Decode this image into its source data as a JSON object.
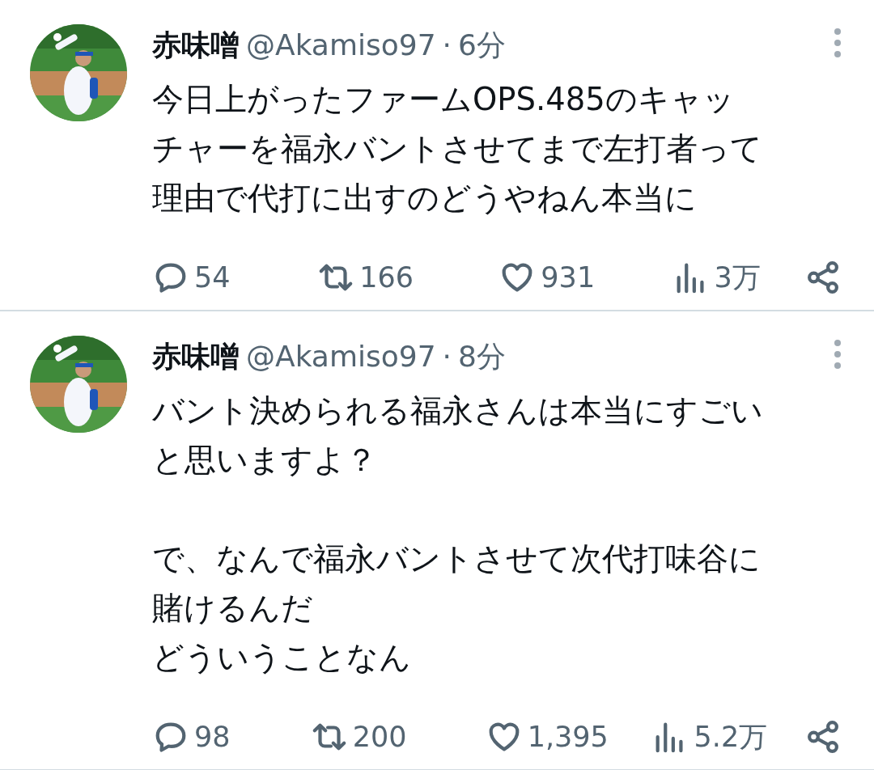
{
  "tweets": [
    {
      "name": "赤味噌",
      "handle": "@Akamiso97",
      "separator": "·",
      "time": "6分",
      "paragraphs": [
        [
          "今日上がったファームOPS.485のキャッ",
          "チャーを福永バントさせてまで左打者って",
          "理由で代打に出すのどうやねん本当に"
        ]
      ],
      "replies": "54",
      "retweets": "166",
      "likes": "931",
      "views": "3万"
    },
    {
      "name": "赤味噌",
      "handle": "@Akamiso97",
      "separator": "·",
      "time": "8分",
      "paragraphs": [
        [
          "バント決められる福永さんは本当にすごい",
          "と思いますよ？"
        ],
        [
          "で、なんで福永バントさせて次代打味谷に",
          "賭けるんだ",
          "どういうことなん"
        ]
      ],
      "replies": "98",
      "retweets": "200",
      "likes": "1,395",
      "views": "5.2万"
    }
  ]
}
